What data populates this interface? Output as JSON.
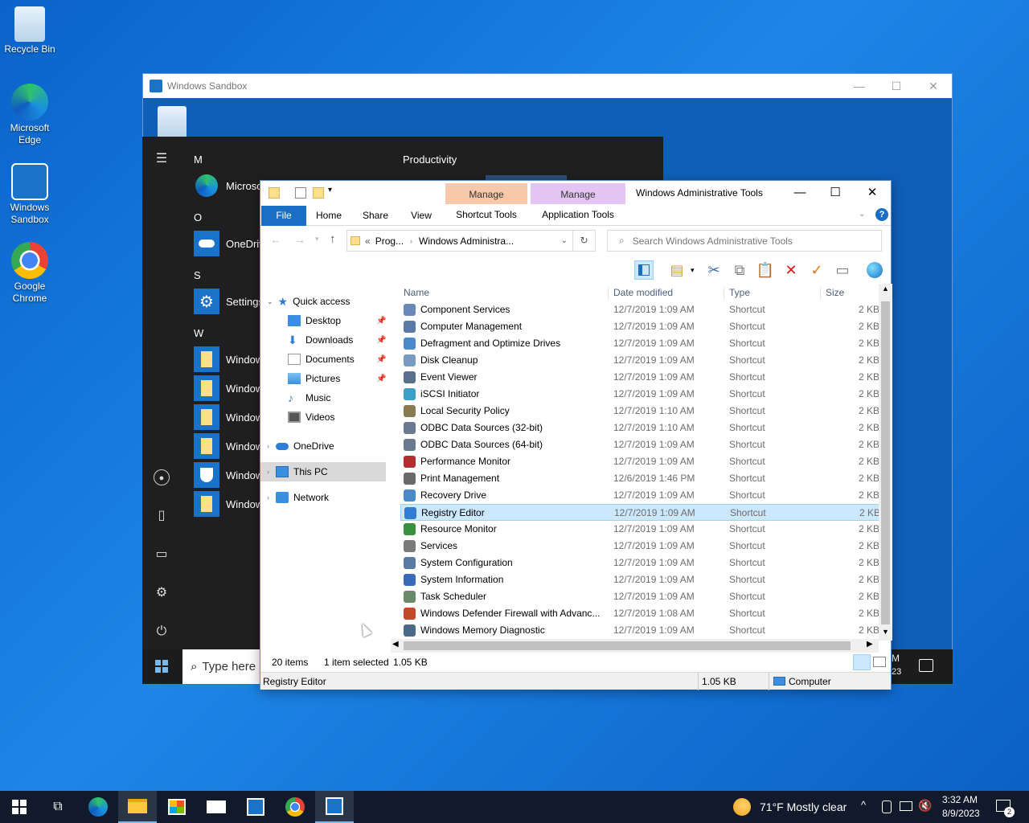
{
  "desktop": {
    "icons": [
      {
        "label": "Recycle Bin",
        "icon": "recycle-bin-icon"
      },
      {
        "label": "Microsoft Edge",
        "icon": "edge-icon"
      },
      {
        "label": "Windows Sandbox",
        "icon": "sandbox-icon"
      },
      {
        "label": "Google Chrome",
        "icon": "chrome-icon"
      }
    ]
  },
  "sandbox": {
    "title": "Windows Sandbox",
    "controls": {
      "minimize": "—",
      "maximize": "☐",
      "close": "✕"
    }
  },
  "startmenu": {
    "letters": [
      "M",
      "O",
      "S",
      "W"
    ],
    "apps": [
      "Microso",
      "OneDriv",
      "Settings",
      "Window",
      "Window",
      "Window",
      "Window",
      "Window",
      "Window"
    ],
    "productivity_label": "Productivity",
    "search_placeholder": "Type here"
  },
  "explorer": {
    "title": "Windows Administrative Tools",
    "context_tabs": [
      {
        "header": "Manage",
        "sub": "Shortcut Tools",
        "color": "#f9c7a9"
      },
      {
        "header": "Manage",
        "sub": "Application Tools",
        "color": "#e4c4f2"
      }
    ],
    "ribbon_tabs": [
      "File",
      "Home",
      "Share",
      "View"
    ],
    "address": {
      "prefix": "«",
      "crumbs": [
        "Prog...",
        "Windows Administra..."
      ]
    },
    "search_placeholder": "Search Windows Administrative Tools",
    "columns": [
      "Name",
      "Date modified",
      "Type",
      "Size"
    ],
    "nav": {
      "quick_access": "Quick access",
      "items": [
        {
          "label": "Desktop",
          "pinned": true
        },
        {
          "label": "Downloads",
          "pinned": true
        },
        {
          "label": "Documents",
          "pinned": true
        },
        {
          "label": "Pictures",
          "pinned": true
        },
        {
          "label": "Music",
          "pinned": false
        },
        {
          "label": "Videos",
          "pinned": false
        }
      ],
      "onedrive": "OneDrive",
      "thispc": "This PC",
      "network": "Network"
    },
    "files": [
      {
        "name": "Component Services",
        "date": "12/7/2019 1:09 AM",
        "type": "Shortcut",
        "size": "2 KB"
      },
      {
        "name": "Computer Management",
        "date": "12/7/2019 1:09 AM",
        "type": "Shortcut",
        "size": "2 KB"
      },
      {
        "name": "Defragment and Optimize Drives",
        "date": "12/7/2019 1:09 AM",
        "type": "Shortcut",
        "size": "2 KB"
      },
      {
        "name": "Disk Cleanup",
        "date": "12/7/2019 1:09 AM",
        "type": "Shortcut",
        "size": "2 KB"
      },
      {
        "name": "Event Viewer",
        "date": "12/7/2019 1:09 AM",
        "type": "Shortcut",
        "size": "2 KB"
      },
      {
        "name": "iSCSI Initiator",
        "date": "12/7/2019 1:09 AM",
        "type": "Shortcut",
        "size": "2 KB"
      },
      {
        "name": "Local Security Policy",
        "date": "12/7/2019 1:10 AM",
        "type": "Shortcut",
        "size": "2 KB"
      },
      {
        "name": "ODBC Data Sources (32-bit)",
        "date": "12/7/2019 1:10 AM",
        "type": "Shortcut",
        "size": "2 KB"
      },
      {
        "name": "ODBC Data Sources (64-bit)",
        "date": "12/7/2019 1:09 AM",
        "type": "Shortcut",
        "size": "2 KB"
      },
      {
        "name": "Performance Monitor",
        "date": "12/7/2019 1:09 AM",
        "type": "Shortcut",
        "size": "2 KB"
      },
      {
        "name": "Print Management",
        "date": "12/6/2019 1:46 PM",
        "type": "Shortcut",
        "size": "2 KB"
      },
      {
        "name": "Recovery Drive",
        "date": "12/7/2019 1:09 AM",
        "type": "Shortcut",
        "size": "2 KB"
      },
      {
        "name": "Registry Editor",
        "date": "12/7/2019 1:09 AM",
        "type": "Shortcut",
        "size": "2 KB",
        "selected": true
      },
      {
        "name": "Resource Monitor",
        "date": "12/7/2019 1:09 AM",
        "type": "Shortcut",
        "size": "2 KB"
      },
      {
        "name": "Services",
        "date": "12/7/2019 1:09 AM",
        "type": "Shortcut",
        "size": "2 KB"
      },
      {
        "name": "System Configuration",
        "date": "12/7/2019 1:09 AM",
        "type": "Shortcut",
        "size": "2 KB"
      },
      {
        "name": "System Information",
        "date": "12/7/2019 1:09 AM",
        "type": "Shortcut",
        "size": "2 KB"
      },
      {
        "name": "Task Scheduler",
        "date": "12/7/2019 1:09 AM",
        "type": "Shortcut",
        "size": "2 KB"
      },
      {
        "name": "Windows Defender Firewall with Advanc...",
        "date": "12/7/2019 1:08 AM",
        "type": "Shortcut",
        "size": "2 KB"
      },
      {
        "name": "Windows Memory Diagnostic",
        "date": "12/7/2019 1:09 AM",
        "type": "Shortcut",
        "size": "2 KB"
      }
    ],
    "status": {
      "count": "20 items",
      "selected": "1 item selected",
      "size": "1.05 KB"
    },
    "info": {
      "name": "Registry Editor",
      "size": "1.05 KB",
      "location": "Computer"
    }
  },
  "sandbox_tray": {
    "time_fragment": "M",
    "date_fragment": "23"
  },
  "taskbar": {
    "weather": "71°F  Mostly clear",
    "time": "3:32 AM",
    "date": "8/9/2023",
    "notification_count": "2"
  },
  "colors": {
    "accent": "#1a6fc4",
    "selection": "#cce8ff",
    "taskbar": "#101a2a"
  }
}
